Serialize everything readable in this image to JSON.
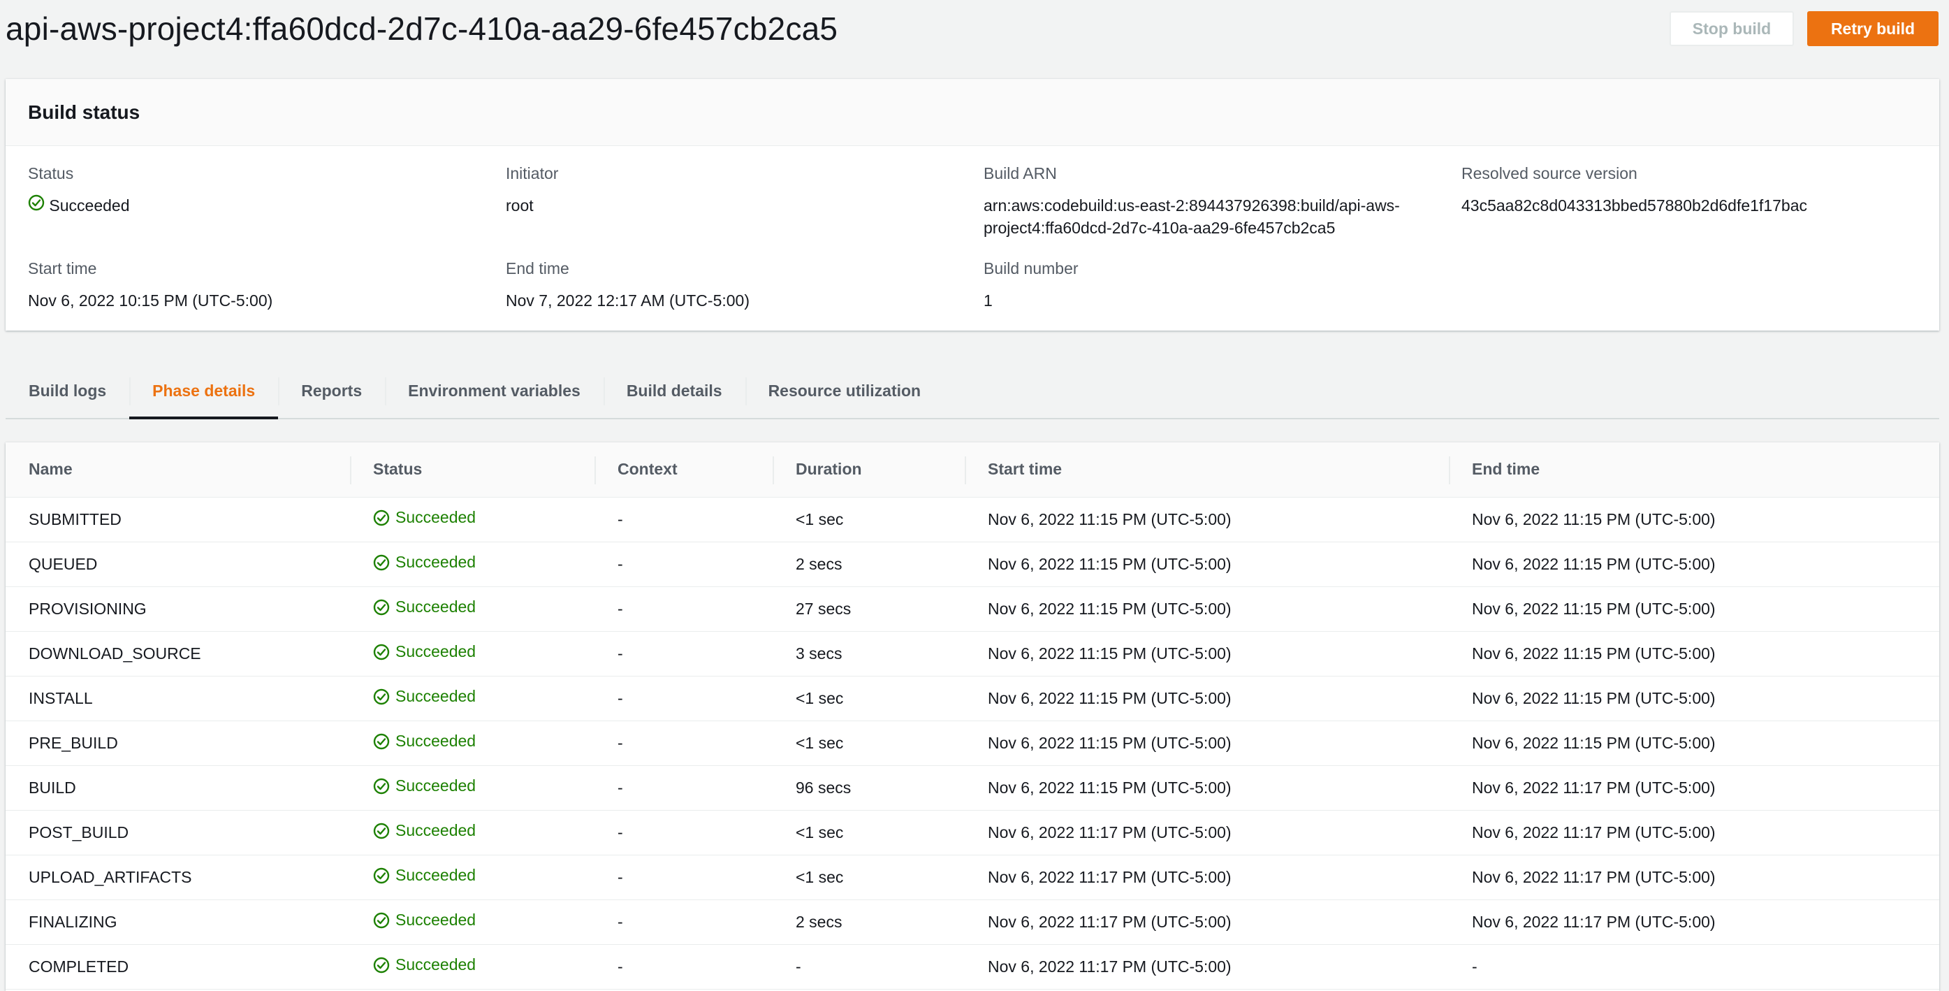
{
  "header": {
    "title": "api-aws-project4:ffa60dcd-2d7c-410a-aa29-6fe457cb2ca5",
    "stop_label": "Stop build",
    "retry_label": "Retry build"
  },
  "build_status": {
    "title": "Build status",
    "fields": {
      "status": {
        "label": "Status",
        "value": "Succeeded"
      },
      "initiator": {
        "label": "Initiator",
        "value": "root"
      },
      "arn": {
        "label": "Build ARN",
        "value_line1": "arn:aws:codebuild:us-east-2:894437926398:build/api-aws-",
        "value_line2": "project4:ffa60dcd-2d7c-410a-aa29-6fe457cb2ca5"
      },
      "source_version": {
        "label": "Resolved source version",
        "value": "43c5aa82c8d043313bbed57880b2d6dfe1f17bac"
      },
      "start_time": {
        "label": "Start time",
        "value": "Nov 6, 2022 10:15 PM (UTC-5:00)"
      },
      "end_time": {
        "label": "End time",
        "value": "Nov 7, 2022 12:17 AM (UTC-5:00)"
      },
      "build_number": {
        "label": "Build number",
        "value": "1"
      }
    }
  },
  "tabs": [
    {
      "label": "Build logs",
      "active": false
    },
    {
      "label": "Phase details",
      "active": true
    },
    {
      "label": "Reports",
      "active": false
    },
    {
      "label": "Environment variables",
      "active": false
    },
    {
      "label": "Build details",
      "active": false
    },
    {
      "label": "Resource utilization",
      "active": false
    }
  ],
  "phases_table": {
    "columns": [
      "Name",
      "Status",
      "Context",
      "Duration",
      "Start time",
      "End time"
    ],
    "rows": [
      {
        "name": "SUBMITTED",
        "status": "Succeeded",
        "context": "-",
        "duration": "<1 sec",
        "start": "Nov 6, 2022 11:15 PM (UTC-5:00)",
        "end": "Nov 6, 2022 11:15 PM (UTC-5:00)"
      },
      {
        "name": "QUEUED",
        "status": "Succeeded",
        "context": "-",
        "duration": "2 secs",
        "start": "Nov 6, 2022 11:15 PM (UTC-5:00)",
        "end": "Nov 6, 2022 11:15 PM (UTC-5:00)"
      },
      {
        "name": "PROVISIONING",
        "status": "Succeeded",
        "context": "-",
        "duration": "27 secs",
        "start": "Nov 6, 2022 11:15 PM (UTC-5:00)",
        "end": "Nov 6, 2022 11:15 PM (UTC-5:00)"
      },
      {
        "name": "DOWNLOAD_SOURCE",
        "status": "Succeeded",
        "context": "-",
        "duration": "3 secs",
        "start": "Nov 6, 2022 11:15 PM (UTC-5:00)",
        "end": "Nov 6, 2022 11:15 PM (UTC-5:00)"
      },
      {
        "name": "INSTALL",
        "status": "Succeeded",
        "context": "-",
        "duration": "<1 sec",
        "start": "Nov 6, 2022 11:15 PM (UTC-5:00)",
        "end": "Nov 6, 2022 11:15 PM (UTC-5:00)"
      },
      {
        "name": "PRE_BUILD",
        "status": "Succeeded",
        "context": "-",
        "duration": "<1 sec",
        "start": "Nov 6, 2022 11:15 PM (UTC-5:00)",
        "end": "Nov 6, 2022 11:15 PM (UTC-5:00)"
      },
      {
        "name": "BUILD",
        "status": "Succeeded",
        "context": "-",
        "duration": "96 secs",
        "start": "Nov 6, 2022 11:15 PM (UTC-5:00)",
        "end": "Nov 6, 2022 11:17 PM (UTC-5:00)"
      },
      {
        "name": "POST_BUILD",
        "status": "Succeeded",
        "context": "-",
        "duration": "<1 sec",
        "start": "Nov 6, 2022 11:17 PM (UTC-5:00)",
        "end": "Nov 6, 2022 11:17 PM (UTC-5:00)"
      },
      {
        "name": "UPLOAD_ARTIFACTS",
        "status": "Succeeded",
        "context": "-",
        "duration": "<1 sec",
        "start": "Nov 6, 2022 11:17 PM (UTC-5:00)",
        "end": "Nov 6, 2022 11:17 PM (UTC-5:00)"
      },
      {
        "name": "FINALIZING",
        "status": "Succeeded",
        "context": "-",
        "duration": "2 secs",
        "start": "Nov 6, 2022 11:17 PM (UTC-5:00)",
        "end": "Nov 6, 2022 11:17 PM (UTC-5:00)"
      },
      {
        "name": "COMPLETED",
        "status": "Succeeded",
        "context": "-",
        "duration": "-",
        "start": "Nov 6, 2022 11:17 PM (UTC-5:00)",
        "end": "-"
      }
    ]
  },
  "icons": {
    "success": "status-success-icon"
  },
  "colors": {
    "accent": "#ec7211",
    "success": "#1d8102",
    "text": "#16191f",
    "muted": "#545b64"
  }
}
